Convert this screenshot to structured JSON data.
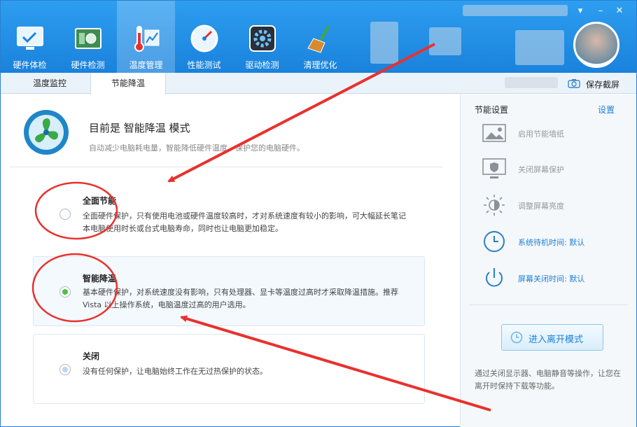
{
  "window": {
    "minimize_glyph": "–",
    "close_glyph": "✕",
    "menu_glyph": "▾"
  },
  "nav": [
    {
      "label": "硬件体检",
      "icon": "monitor-check-icon"
    },
    {
      "label": "硬件检测",
      "icon": "board-icon"
    },
    {
      "label": "温度管理",
      "icon": "thermometer-icon",
      "active": true
    },
    {
      "label": "性能测试",
      "icon": "speedometer-icon"
    },
    {
      "label": "驱动检测",
      "icon": "gear-box-icon"
    },
    {
      "label": "清理优化",
      "icon": "broom-icon"
    }
  ],
  "tabs": [
    {
      "label": "温度监控"
    },
    {
      "label": "节能降温",
      "active": true
    }
  ],
  "screenshot_label": "保存截屏",
  "header": {
    "title": "目前是 智能降温 模式",
    "desc": "自动减少电脑耗电量，智能降低硬件温度，保护您的电脑硬件。"
  },
  "options": [
    {
      "title": "全面节能",
      "desc": "全面硬件保护，只有使用电池或硬件温度较高时，才对系统速度有较小的影响，可大幅延长笔记本电脑使用时长或台式电脑寿命，同时也让电脑更加稳定。",
      "selected": false
    },
    {
      "title": "智能降温",
      "desc": "基本硬件保护，对系统速度没有影响，只有处理器、显卡等温度过高时才采取降温措施。推荐 Vista 以上操作系统，电脑温度过高的用户选用。",
      "selected": true
    },
    {
      "title": "关闭",
      "desc": "没有任何保护，让电脑始终工作在无过热保护的状态。",
      "selected": false
    }
  ],
  "sidebar": {
    "title": "节能设置",
    "settings_link": "设置",
    "items": [
      {
        "label": "启用节能墙纸",
        "icon": "picture-icon",
        "active": false
      },
      {
        "label": "关闭屏幕保护",
        "icon": "monitor-shield-icon",
        "active": false
      },
      {
        "label": "调整屏幕亮度",
        "icon": "brightness-icon",
        "active": false
      },
      {
        "label": "系统待机时间: 默认",
        "icon": "clock-icon",
        "active": true
      },
      {
        "label": "屏幕关闭时间: 默认",
        "icon": "power-icon",
        "active": true
      }
    ],
    "leave_button": "进入离开模式",
    "note": "通过关闭显示器、电脑静音等操作，让您在离开时保持下载等功能。"
  },
  "colors": {
    "accent": "#1b7fd6",
    "header": "#2d9ef0",
    "annotation": "#e8312d",
    "selected_dot": "#4cc13f"
  }
}
